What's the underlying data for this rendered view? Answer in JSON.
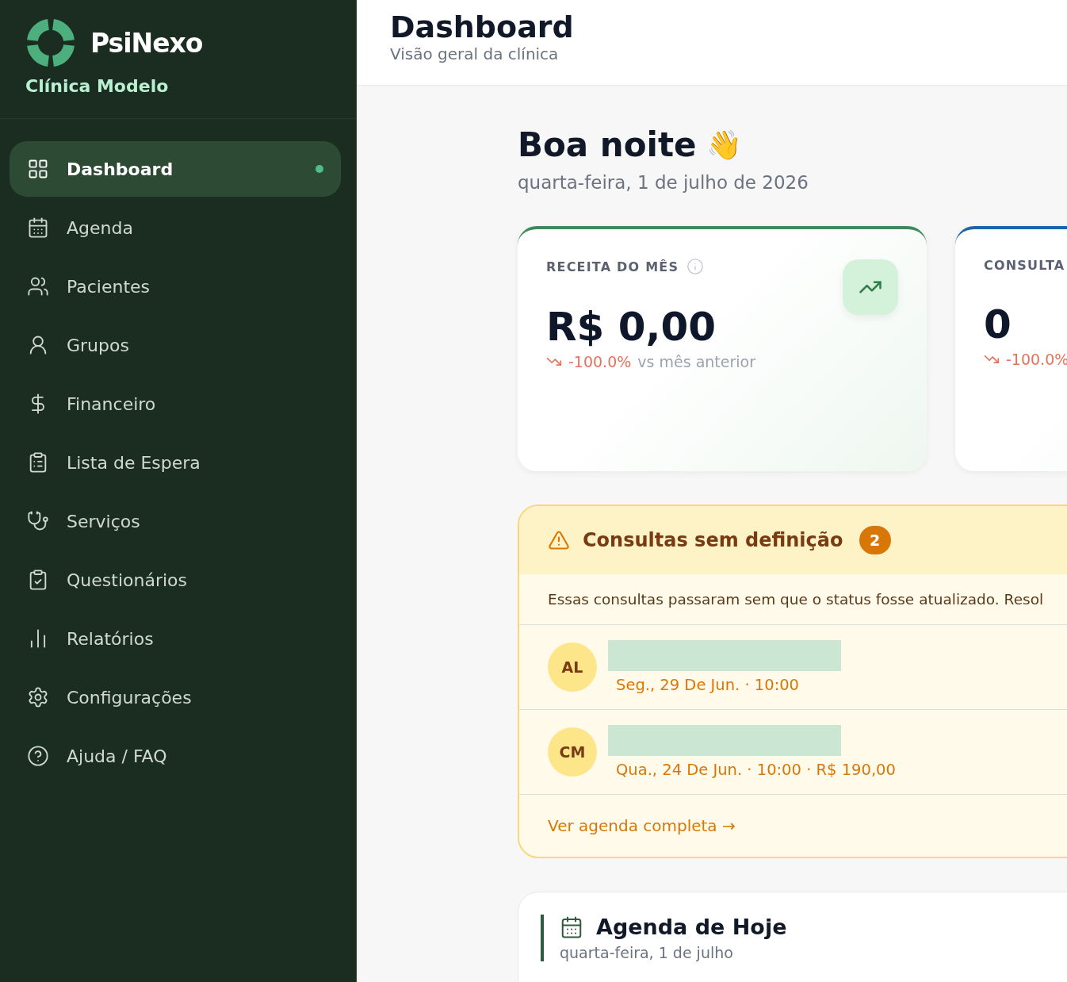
{
  "sidebar": {
    "brand": "PsiNexo",
    "clinic": "Clínica Modelo",
    "items": [
      {
        "label": "Dashboard",
        "selected": true
      },
      {
        "label": "Agenda",
        "selected": false
      },
      {
        "label": "Pacientes",
        "selected": false
      },
      {
        "label": "Grupos",
        "selected": false
      },
      {
        "label": "Financeiro",
        "selected": false
      },
      {
        "label": "Lista de Espera",
        "selected": false
      },
      {
        "label": "Serviços",
        "selected": false
      },
      {
        "label": "Questionários",
        "selected": false
      },
      {
        "label": "Relatórios",
        "selected": false
      },
      {
        "label": "Configurações",
        "selected": false
      },
      {
        "label": "Ajuda / FAQ",
        "selected": false
      }
    ]
  },
  "header": {
    "title": "Dashboard",
    "subtitle": "Visão geral da clínica"
  },
  "greeting": {
    "title": "Boa noite",
    "emoji": "👋",
    "date": "quarta-feira, 1 de julho de 2026"
  },
  "stats": [
    {
      "label": "RECEITA DO MÊS",
      "value": "R$ 0,00",
      "change": "-100.0%",
      "note": "vs mês anterior",
      "color": "#3f8a5c"
    },
    {
      "label": "CONSULTA",
      "value": "0",
      "change": "-100.0%",
      "color": "#1f63a8"
    }
  ],
  "alert": {
    "title": "Consultas sem definição",
    "count": "2",
    "description": "Essas consultas passaram sem que o status fosse atualizado. Resol",
    "rows": [
      {
        "initials": "AL",
        "detail": "Seg., 29 De Jun. · 10:00"
      },
      {
        "initials": "CM",
        "detail": "Qua., 24 De Jun. · 10:00 · R$ 190,00"
      }
    ],
    "link": "Ver agenda completa →"
  },
  "agenda": {
    "title": "Agenda de Hoje",
    "date": "quarta-feira, 1 de julho"
  }
}
